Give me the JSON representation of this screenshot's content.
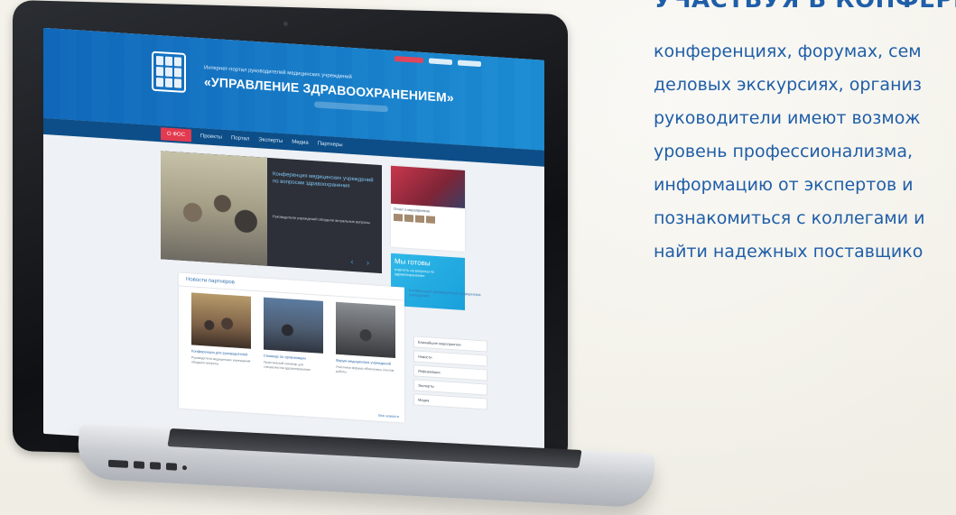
{
  "right_panel": {
    "headline": "УЧАСТВУЯ В КОНФЕРЕНЦ",
    "lines": [
      "конференциях, форумах, сем",
      "деловых экскурсиях, организ",
      "руководители имеют возмож",
      "уровень профессионализма,",
      "информацию от экспертов и",
      "познакомиться с коллегами и",
      "найти надежных поставщико"
    ]
  },
  "site": {
    "portal_subtitle": "Интернет-портал руководителей медицинских учреждений",
    "portal_title": "«УПРАВЛЕНИЕ ЗДРАВООХРАНЕНИЕМ»",
    "nav": {
      "items": [
        "О ФОС",
        "Проекты",
        "Портал",
        "Эксперты",
        "Медиа",
        "Партнеры"
      ]
    },
    "slider": {
      "caption": "Конференция медицинских учреждений по вопросам здравоохранения",
      "body": "Руководители учреждений обсудили актуальные вопросы",
      "arrows": "‹ ›"
    },
    "side_card": {
      "label": "Отчет о мероприятии"
    },
    "promo": {
      "title": "Мы готовы",
      "text": "ответить на вопросы по здравоохранению"
    },
    "news": {
      "title": "Новости партнеров",
      "cards": [
        {
          "caption": "Конференция для руководителей",
          "text": "Руководители медицинских учреждений обсудили вопросы"
        },
        {
          "caption": "Семинар по организации",
          "text": "Практический семинар для специалистов здравоохранения"
        },
        {
          "caption": "Форум медицинских учреждений",
          "text": "Участники форума обменялись опытом работы"
        }
      ],
      "all_link": "Все новости"
    },
    "event_text": "Конференция руководителей медицинских учреждений",
    "side_list": [
      "Ближайшие мероприятия",
      "Новости",
      "Информация",
      "Эксперты",
      "Медиа"
    ]
  }
}
